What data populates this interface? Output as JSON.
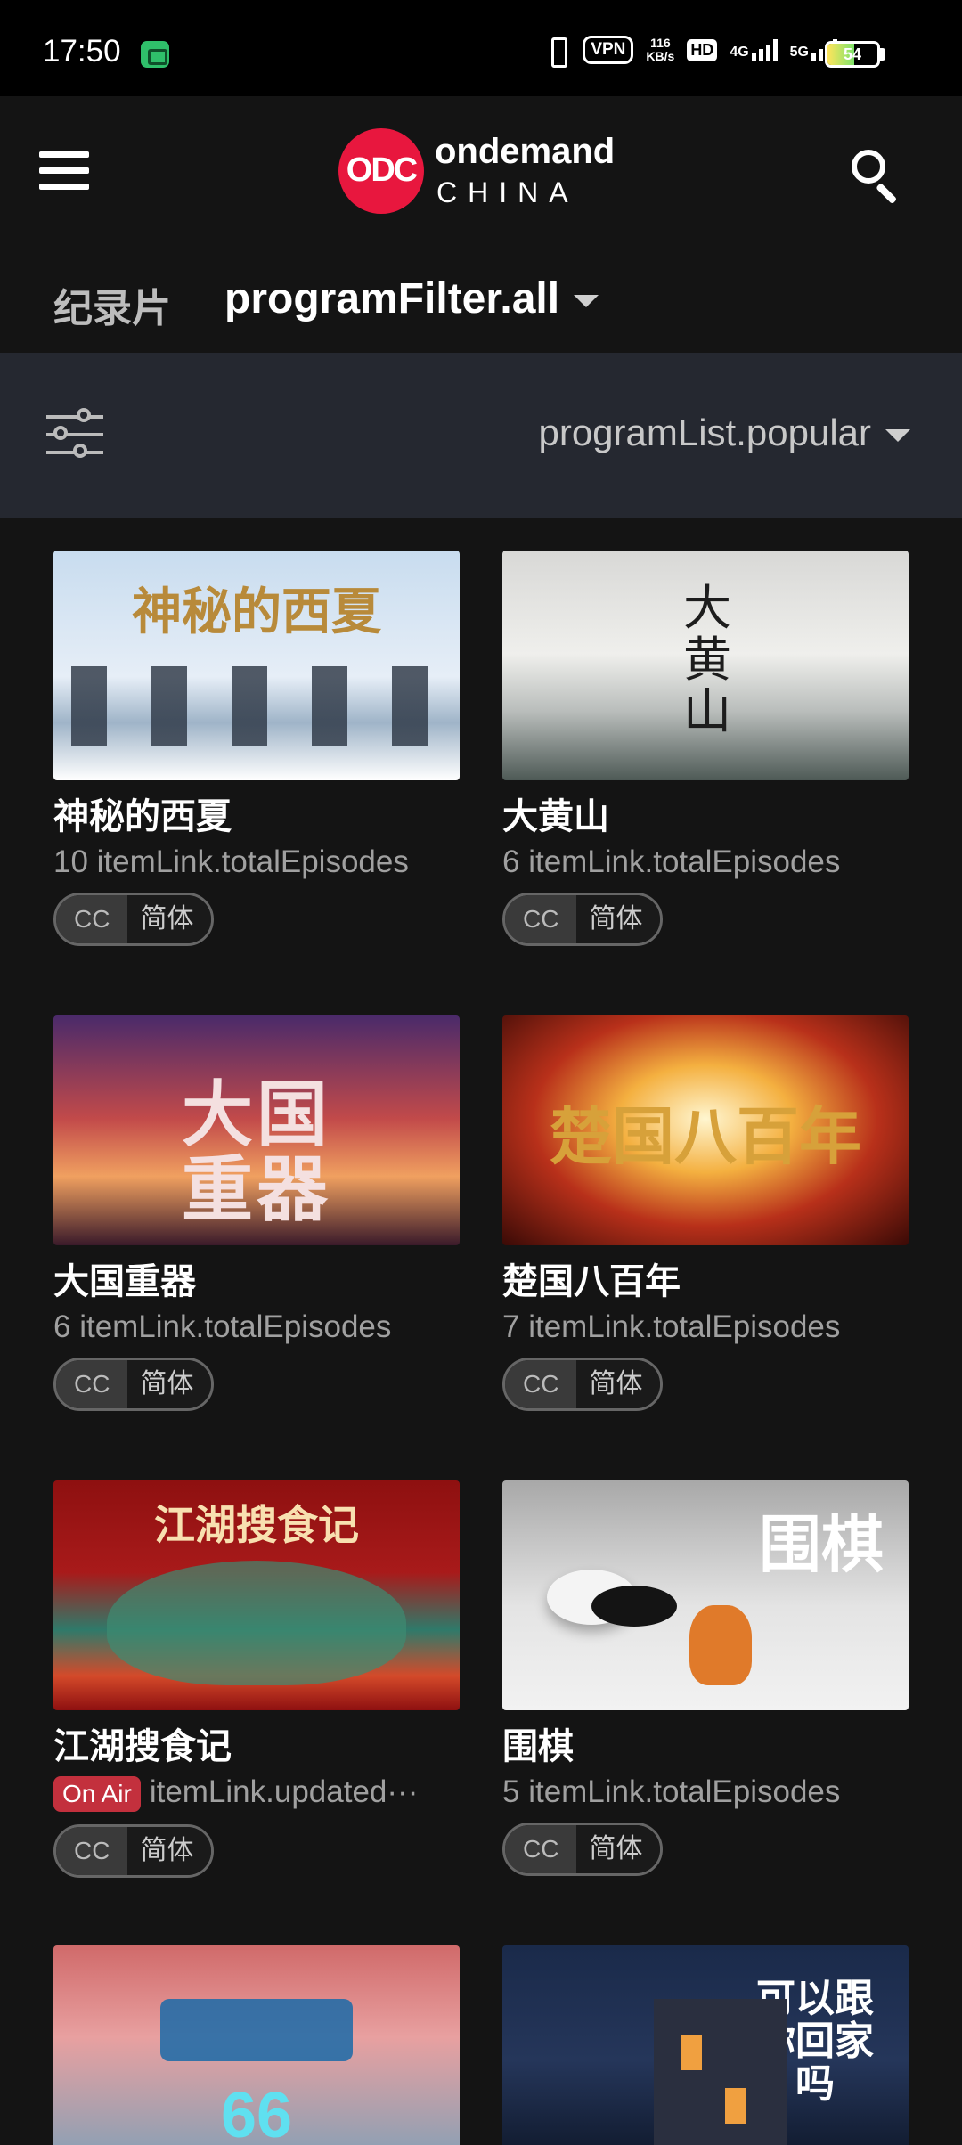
{
  "status_bar": {
    "time": "17:50",
    "vpn": "VPN",
    "speed_value": "116",
    "speed_unit": "KB/s",
    "hd": "HD",
    "net1": "4G",
    "net2": "5G",
    "battery": "54",
    "battery_level": 0.54
  },
  "header": {
    "menu_icon": "hamburger-icon",
    "logo_mark": "ODC",
    "logo_line1": "ondemand",
    "logo_line2": "CHINA",
    "search_icon": "search-icon"
  },
  "filter": {
    "category": "纪录片",
    "program_filter": "programFilter.all"
  },
  "sort": {
    "settings_icon": "sliders-icon",
    "label": "programList.popular"
  },
  "programs": [
    {
      "title": "神秘的西夏",
      "subtitle": "10 itemLink.totalEpisodes",
      "on_air": "",
      "cc": "CC",
      "lang": "简体",
      "thumb_text": "神秘的西夏"
    },
    {
      "title": "大黄山",
      "subtitle": "6 itemLink.totalEpisodes",
      "on_air": "",
      "cc": "CC",
      "lang": "简体",
      "thumb_text": "大黄山"
    },
    {
      "title": "大国重器",
      "subtitle": "6 itemLink.totalEpisodes",
      "on_air": "",
      "cc": "CC",
      "lang": "简体",
      "thumb_text": "大国重器"
    },
    {
      "title": "楚国八百年",
      "subtitle": "7 itemLink.totalEpisodes",
      "on_air": "",
      "cc": "CC",
      "lang": "简体",
      "thumb_text": "楚国八百年"
    },
    {
      "title": "江湖搜食记",
      "subtitle": "itemLink.updated···",
      "on_air": "On Air",
      "cc": "CC",
      "lang": "简体",
      "thumb_text": "江湖搜食记"
    },
    {
      "title": "围棋",
      "subtitle": "5 itemLink.totalEpisodes",
      "on_air": "",
      "cc": "CC",
      "lang": "简体",
      "thumb_text": "围棋"
    },
    {
      "title": "",
      "subtitle": "",
      "on_air": "",
      "cc": "",
      "lang": "",
      "thumb_text": "66"
    },
    {
      "title": "",
      "subtitle": "",
      "on_air": "",
      "cc": "",
      "lang": "",
      "thumb_text": "可以跟你回家吗"
    }
  ]
}
